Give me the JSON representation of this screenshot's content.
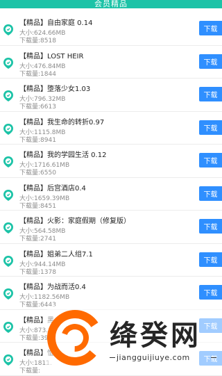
{
  "header": {
    "title": "会员精品"
  },
  "download_label": "下载",
  "size_prefix": "大小:",
  "downloads_prefix": "下载量:",
  "items": [
    {
      "name": "【精品】自由家庭 0.14",
      "size": "624.66MB",
      "downloads": "8518"
    },
    {
      "name": "【精品】LOST HEIR",
      "size": "476.84MB",
      "downloads": "1844"
    },
    {
      "name": "【精品】堕落少女1.03",
      "size": "796.32MB",
      "downloads": "6613"
    },
    {
      "name": "【精品】我生命的转折0.97",
      "size": "1115.8MB",
      "downloads": "8941"
    },
    {
      "name": "【精品】我的学园生活 0.12",
      "size": "1716.61MB",
      "downloads": "6550"
    },
    {
      "name": "【精品】后宫酒店0.4",
      "size": "1659.39MB",
      "downloads": "8451"
    },
    {
      "name": "【精品】火影：家庭假期（修复版）",
      "size": "564.58MB",
      "downloads": "2741"
    },
    {
      "name": "【精品】姐弟二人组7.1",
      "size": "944.14MB",
      "downloads": "1378"
    },
    {
      "name": "【精品】为战而活0.4",
      "size": "1182.56MB",
      "downloads": "6443"
    },
    {
      "name": "【精品】黑",
      "size": "873.5",
      "downloads": "391"
    },
    {
      "name": "【精品】恤",
      "size": "1811.",
      "downloads": ""
    }
  ],
  "watermark": {
    "name": "绛癸网",
    "url": "jiangguijiuye.com"
  }
}
